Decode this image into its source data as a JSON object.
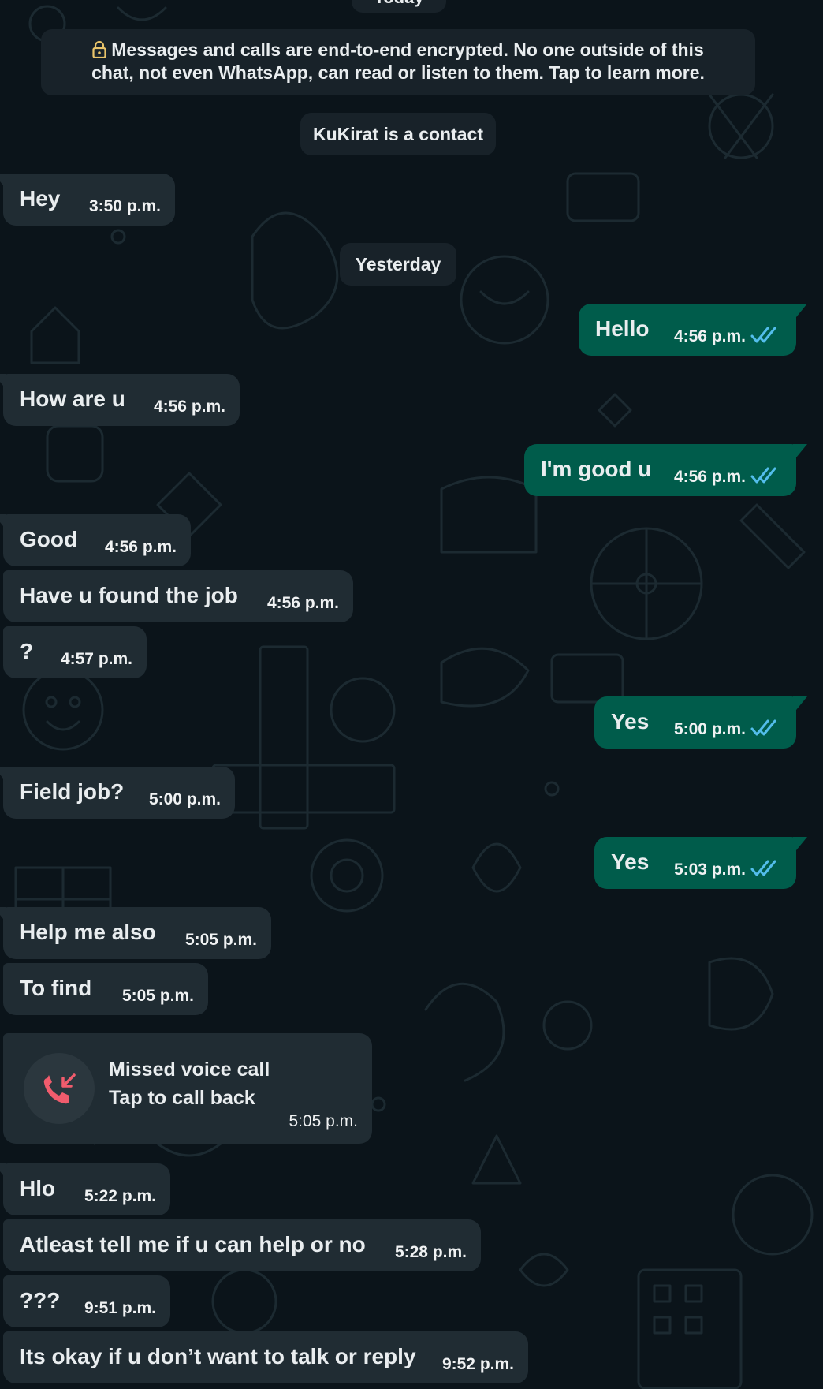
{
  "chat": {
    "encryption_notice": "Messages and calls are end-to-end encrypted. No one outside of this chat, not even WhatsApp, can read or listen to them. Tap to learn more.",
    "contact_notice": "KuKirat is a contact",
    "date_separator": "Yesterday",
    "top_pill_partial": "Today"
  },
  "messages": [
    {
      "dir": "in",
      "text": "Hey",
      "time": "3:50 p.m."
    },
    {
      "dir": "out",
      "text": "Hello",
      "time": "4:56 p.m.",
      "status": "read"
    },
    {
      "dir": "in",
      "text": "How are u",
      "time": "4:56 p.m."
    },
    {
      "dir": "out",
      "text": "I'm good u",
      "time": "4:56 p.m.",
      "status": "read"
    },
    {
      "dir": "in",
      "text": "Good",
      "time": "4:56 p.m."
    },
    {
      "dir": "in",
      "text": "Have u found the job",
      "time": "4:56 p.m."
    },
    {
      "dir": "in",
      "text": "?",
      "time": "4:57 p.m."
    },
    {
      "dir": "out",
      "text": "Yes",
      "time": "5:00 p.m.",
      "status": "read"
    },
    {
      "dir": "in",
      "text": "Field job?",
      "time": "5:00 p.m."
    },
    {
      "dir": "out",
      "text": "Yes",
      "time": "5:03 p.m.",
      "status": "read"
    },
    {
      "dir": "in",
      "text": "Help me also",
      "time": "5:05 p.m."
    },
    {
      "dir": "in",
      "text": "To find",
      "time": "5:05 p.m."
    },
    {
      "dir": "in",
      "text": "Hlo",
      "time": "5:22 p.m."
    },
    {
      "dir": "in",
      "text": "Atleast tell me if u can help or no",
      "time": "5:28 p.m."
    },
    {
      "dir": "in",
      "text": "???",
      "time": "9:51 p.m."
    },
    {
      "dir": "in",
      "text": "Its okay if u don’t want to talk or reply",
      "time": "9:52 p.m."
    }
  ],
  "missed_call": {
    "title": "Missed voice call",
    "subtitle": "Tap to call back",
    "time": "5:05 p.m.",
    "icon": "missed-call-icon"
  },
  "colors": {
    "background": "#0b141a",
    "incoming_bubble": "#202c33",
    "outgoing_bubble": "#005c4b",
    "read_ticks": "#53bdeb",
    "missed_call_red": "#f15c6d",
    "lock_icon": "#e9c46a"
  },
  "icons": {
    "lock": "lock-icon",
    "read_receipt": "double-check-icon"
  }
}
